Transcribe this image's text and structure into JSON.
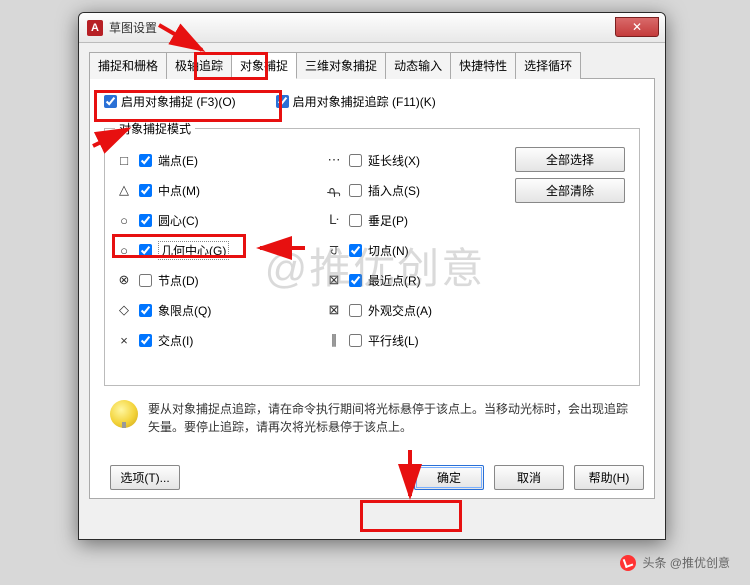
{
  "window": {
    "title": "草图设置",
    "close_label": "✕"
  },
  "tabs": {
    "items": [
      {
        "label": "捕捉和栅格"
      },
      {
        "label": "极轴追踪"
      },
      {
        "label": "对象捕捉"
      },
      {
        "label": "三维对象捕捉"
      },
      {
        "label": "动态输入"
      },
      {
        "label": "快捷特性"
      },
      {
        "label": "选择循环"
      }
    ],
    "active_index": 2
  },
  "top_checks": {
    "enable_osnap": {
      "label": "启用对象捕捉 (F3)(O)",
      "checked": true
    },
    "enable_track": {
      "label": "启用对象捕捉追踪 (F11)(K)",
      "checked": true
    }
  },
  "group_legend": "对象捕捉模式",
  "left_modes": [
    {
      "sym": "□",
      "label": "端点(E)",
      "checked": true
    },
    {
      "sym": "△",
      "label": "中点(M)",
      "checked": true
    },
    {
      "sym": "○",
      "label": "圆心(C)",
      "checked": true
    },
    {
      "sym": "○",
      "label": "几何中心(G)",
      "checked": true
    },
    {
      "sym": "⊗",
      "label": "节点(D)",
      "checked": false
    },
    {
      "sym": "◇",
      "label": "象限点(Q)",
      "checked": true
    },
    {
      "sym": "×",
      "label": "交点(I)",
      "checked": true
    }
  ],
  "right_modes": [
    {
      "sym": "⋯",
      "label": "延长线(X)",
      "checked": false
    },
    {
      "sym": "᠊ᠲ",
      "label": "插入点(S)",
      "checked": false
    },
    {
      "sym": "ᒷ",
      "label": "垂足(P)",
      "checked": false
    },
    {
      "sym": "ਹ",
      "label": "切点(N)",
      "checked": true
    },
    {
      "sym": "⊠",
      "label": "最近点(R)",
      "checked": true
    },
    {
      "sym": "⊠",
      "label": "外观交点(A)",
      "checked": false
    },
    {
      "sym": "∥",
      "label": "平行线(L)",
      "checked": false
    }
  ],
  "side_buttons": {
    "select_all": "全部选择",
    "clear_all": "全部清除"
  },
  "tip_text": "要从对象捕捉点追踪，请在命令执行期间将光标悬停于该点上。当移动光标时，会出现追踪矢量。要停止追踪，请再次将光标悬停于该点上。",
  "footer": {
    "options": "选项(T)...",
    "ok": "确定",
    "cancel": "取消",
    "help": "帮助(H)"
  },
  "watermark": "@推优创意",
  "credit": "头条 @推优创意"
}
